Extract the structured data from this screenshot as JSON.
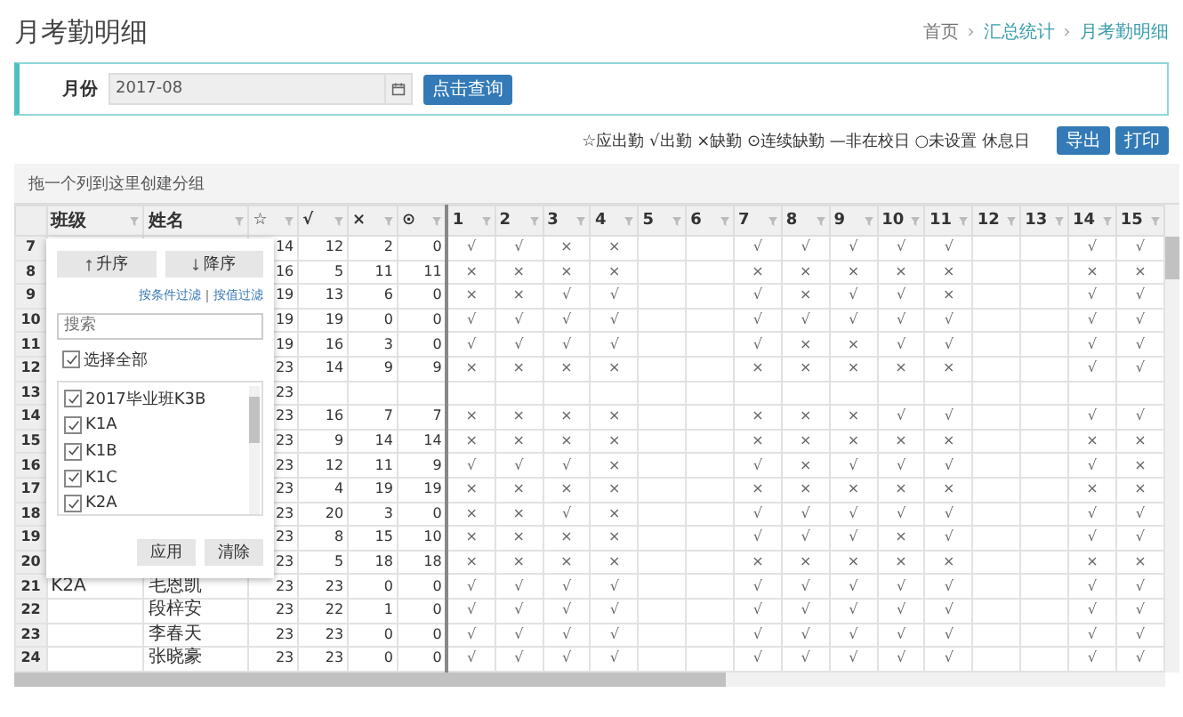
{
  "page_title": "月考勤明细",
  "breadcrumb": [
    "首页",
    "汇总统计",
    "月考勤明细"
  ],
  "filter": {
    "label": "月份",
    "value": "2017-08",
    "button": "点击查询"
  },
  "legend": "☆应出勤 √出勤 ×缺勤 ⊙连续缺勤 —非在校日 ○未设置 休息日",
  "actions": [
    "导出",
    "打印"
  ],
  "group_hint": "拖一个列到这里创建分组",
  "columns": [
    "班级",
    "姓名",
    "☆",
    "√",
    "×",
    "⊙",
    "1",
    "2",
    "3",
    "4",
    "5",
    "6",
    "7",
    "8",
    "9",
    "10",
    "11",
    "12",
    "13",
    "14",
    "15"
  ],
  "rows": [
    {
      "number": "7",
      "stats": [
        "14",
        "12",
        "2",
        "0"
      ],
      "days": {
        "day_1": "√",
        "day_2": "√",
        "day_3": "×",
        "day_4": "×",
        "day_7": "√",
        "day_8": "√",
        "day_9": "√",
        "day_10": "√",
        "day_11": "√",
        "day_14": "√",
        "day_15": "√"
      }
    },
    {
      "number": "8",
      "stats": [
        "16",
        "5",
        "11",
        "11"
      ],
      "days": {
        "day_1": "×",
        "day_2": "×",
        "day_3": "×",
        "day_4": "×",
        "day_7": "×",
        "day_8": "×",
        "day_9": "×",
        "day_10": "×",
        "day_11": "×",
        "day_14": "×",
        "day_15": "×"
      }
    },
    {
      "number": "9",
      "stats": [
        "19",
        "13",
        "6",
        "0"
      ],
      "days": {
        "day_1": "×",
        "day_2": "×",
        "day_3": "√",
        "day_4": "√",
        "day_7": "√",
        "day_8": "×",
        "day_9": "√",
        "day_10": "√",
        "day_11": "×",
        "day_14": "√",
        "day_15": "√"
      }
    },
    {
      "number": "10",
      "stats": [
        "19",
        "19",
        "0",
        "0"
      ],
      "days": {
        "day_1": "√",
        "day_2": "√",
        "day_3": "√",
        "day_4": "√",
        "day_7": "√",
        "day_8": "√",
        "day_9": "√",
        "day_10": "√",
        "day_11": "√",
        "day_14": "√",
        "day_15": "√"
      }
    },
    {
      "number": "11",
      "stats": [
        "19",
        "16",
        "3",
        "0"
      ],
      "days": {
        "day_1": "√",
        "day_2": "√",
        "day_3": "√",
        "day_4": "√",
        "day_7": "√",
        "day_8": "×",
        "day_9": "×",
        "day_10": "√",
        "day_11": "√",
        "day_14": "√",
        "day_15": "√"
      }
    },
    {
      "number": "12",
      "stats": [
        "23",
        "14",
        "9",
        "9"
      ],
      "days": {
        "day_1": "×",
        "day_2": "×",
        "day_3": "×",
        "day_4": "×",
        "day_7": "×",
        "day_8": "×",
        "day_9": "×",
        "day_10": "×",
        "day_11": "×",
        "day_14": "√",
        "day_15": "√"
      }
    },
    {
      "number": "13",
      "stats": [
        "23"
      ]
    },
    {
      "number": "14",
      "stats": [
        "23",
        "16",
        "7",
        "7"
      ],
      "days": {
        "day_1": "×",
        "day_2": "×",
        "day_3": "×",
        "day_4": "×",
        "day_7": "×",
        "day_8": "×",
        "day_9": "×",
        "day_10": "√",
        "day_11": "√",
        "day_14": "√",
        "day_15": "√"
      }
    },
    {
      "number": "15",
      "stats": [
        "23",
        "9",
        "14",
        "14"
      ],
      "days": {
        "day_1": "×",
        "day_2": "×",
        "day_3": "×",
        "day_4": "×",
        "day_7": "×",
        "day_8": "×",
        "day_9": "×",
        "day_10": "×",
        "day_11": "×",
        "day_14": "×",
        "day_15": "×"
      }
    },
    {
      "number": "16",
      "stats": [
        "23",
        "12",
        "11",
        "9"
      ],
      "days": {
        "day_1": "√",
        "day_2": "√",
        "day_3": "√",
        "day_4": "×",
        "day_7": "√",
        "day_8": "×",
        "day_9": "√",
        "day_10": "√",
        "day_11": "√",
        "day_14": "√",
        "day_15": "×"
      }
    },
    {
      "number": "17",
      "stats": [
        "23",
        "4",
        "19",
        "19"
      ],
      "days": {
        "day_1": "×",
        "day_2": "×",
        "day_3": "×",
        "day_4": "×",
        "day_7": "×",
        "day_8": "×",
        "day_9": "×",
        "day_10": "×",
        "day_11": "×",
        "day_14": "×",
        "day_15": "×"
      }
    },
    {
      "number": "18",
      "stats": [
        "23",
        "20",
        "3",
        "0"
      ],
      "days": {
        "day_1": "×",
        "day_2": "×",
        "day_3": "√",
        "day_4": "×",
        "day_7": "√",
        "day_8": "√",
        "day_9": "√",
        "day_10": "√",
        "day_11": "√",
        "day_14": "√",
        "day_15": "√"
      }
    },
    {
      "number": "19",
      "stats": [
        "23",
        "8",
        "15",
        "10"
      ],
      "days": {
        "day_1": "×",
        "day_2": "×",
        "day_3": "×",
        "day_4": "×",
        "day_7": "√",
        "day_8": "√",
        "day_9": "√",
        "day_10": "×",
        "day_11": "√",
        "day_14": "√",
        "day_15": "√"
      }
    },
    {
      "number": "20",
      "stats": [
        "23",
        "5",
        "18",
        "18"
      ],
      "days": {
        "day_1": "×",
        "day_2": "×",
        "day_3": "×",
        "day_4": "×",
        "day_7": "×",
        "day_8": "×",
        "day_9": "×",
        "day_10": "×",
        "day_11": "×",
        "day_14": "×",
        "day_15": "×"
      }
    },
    {
      "number": "21",
      "class": "K2A",
      "name": "毛恩凯",
      "stats": [
        "23",
        "23",
        "0",
        "0"
      ],
      "days": {
        "day_1": "√",
        "day_2": "√",
        "day_3": "√",
        "day_4": "√",
        "day_7": "√",
        "day_8": "√",
        "day_9": "√",
        "day_10": "√",
        "day_11": "√",
        "day_14": "√",
        "day_15": "√"
      }
    },
    {
      "number": "22",
      "name": "段梓安",
      "stats": [
        "23",
        "22",
        "1",
        "0"
      ],
      "days": {
        "day_1": "√",
        "day_2": "√",
        "day_3": "√",
        "day_4": "√",
        "day_7": "√",
        "day_8": "√",
        "day_9": "√",
        "day_10": "√",
        "day_11": "√",
        "day_14": "√",
        "day_15": "√"
      }
    },
    {
      "number": "23",
      "name": "李春天",
      "stats": [
        "23",
        "23",
        "0",
        "0"
      ],
      "days": {
        "day_1": "√",
        "day_2": "√",
        "day_3": "√",
        "day_4": "√",
        "day_7": "√",
        "day_8": "√",
        "day_9": "√",
        "day_10": "√",
        "day_11": "√",
        "day_14": "√",
        "day_15": "√"
      }
    },
    {
      "number": "24",
      "name": "张晓豪",
      "stats": [
        "23",
        "23",
        "0",
        "0"
      ],
      "days": {
        "day_1": "√",
        "day_2": "√",
        "day_3": "√",
        "day_4": "√",
        "day_7": "√",
        "day_8": "√",
        "day_9": "√",
        "day_10": "√",
        "day_11": "√",
        "day_14": "√",
        "day_15": "√"
      }
    }
  ],
  "popup": {
    "sort_buttons": [
      {
        "label": "升序",
        "kind": "asc"
      },
      {
        "label": "降序",
        "kind": "desc"
      }
    ],
    "filter_links": [
      "按条件过滤",
      "按值过滤"
    ],
    "search": {
      "placeholder": "搜索"
    },
    "select_all": {
      "label": "选择全部",
      "checked": true
    },
    "options": [
      {
        "label": "2017毕业班K3B",
        "checked": true
      },
      {
        "label": "K1A",
        "checked": true
      },
      {
        "label": "K1B",
        "checked": true
      },
      {
        "label": "K1C",
        "checked": true
      },
      {
        "label": "K2A",
        "checked": true
      }
    ],
    "buttons": [
      "应用",
      "清除"
    ]
  }
}
